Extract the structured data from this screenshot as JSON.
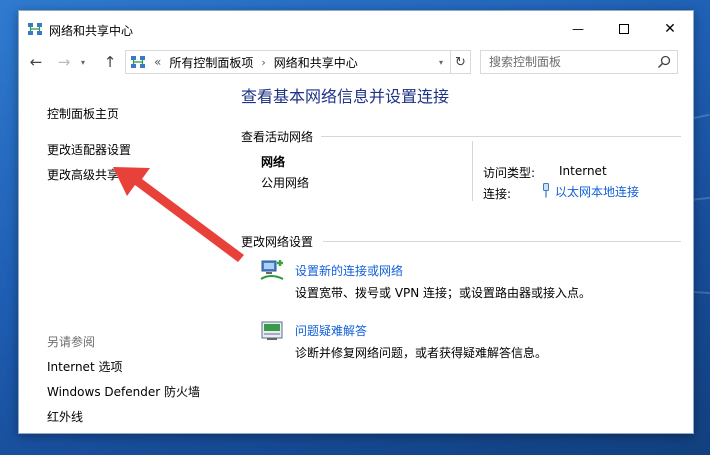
{
  "window": {
    "title": "网络和共享中心",
    "minimize_glyph": "—",
    "close_glyph": "✕"
  },
  "navbar": {
    "back_glyph": "←",
    "forward_glyph": "→",
    "dropdown_glyph": "▾",
    "up_glyph": "↑",
    "address": {
      "overflow": "«",
      "crumbs": [
        "所有控制面板项",
        "网络和共享中心"
      ],
      "separator": "›",
      "dropdown_glyph": "▾",
      "refresh_glyph": "↻"
    },
    "search": {
      "placeholder": "搜索控制面板",
      "value": ""
    }
  },
  "left_pane": {
    "links": [
      "控制面板主页",
      "更改适配器设置",
      "更改高级共享设置"
    ],
    "see_also_heading": "另请参阅",
    "see_also": [
      "Internet 选项",
      "Windows Defender 防火墙",
      "红外线"
    ]
  },
  "main": {
    "title": "查看基本网络信息并设置连接",
    "active_networks_label": "查看活动网络",
    "network": {
      "name": "网络",
      "category": "公用网络",
      "access_type_label": "访问类型:",
      "access_type_value": "Internet",
      "connection_label": "连接:",
      "connection_value": "以太网本地连接"
    },
    "change_settings_label": "更改网络设置",
    "tasks": [
      {
        "link": "设置新的连接或网络",
        "desc": "设置宽带、拨号或 VPN 连接；或设置路由器或接入点。"
      },
      {
        "link": "问题疑难解答",
        "desc": "诊断并修复网络问题，或者获得疑难解答信息。"
      }
    ]
  },
  "colors": {
    "link": "#1060d8",
    "title": "#1e3287",
    "annotation_arrow": "#e8413a",
    "wallpaper": "#1f5fb4"
  },
  "icons": {
    "title": "network-center-icon",
    "address": "network-center-icon",
    "search": "magnifier-icon",
    "connection": "ethernet-plug-icon",
    "task_new_connection": "new-connection-icon",
    "task_troubleshoot": "troubleshoot-icon"
  }
}
